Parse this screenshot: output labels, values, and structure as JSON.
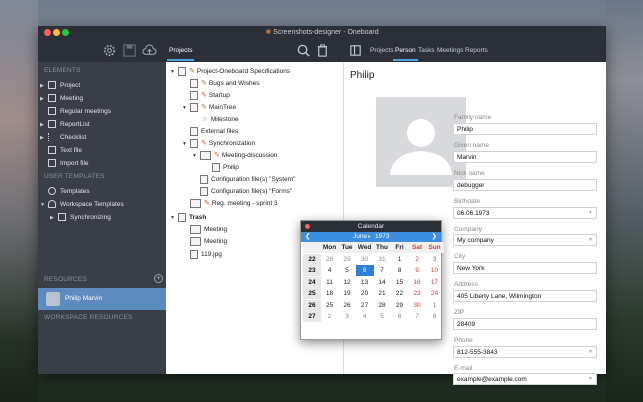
{
  "window": {
    "title": "Screenshots-designer - Oneboard"
  },
  "toolbar": {
    "left_tab": "Projects",
    "tabs": [
      {
        "label": "Projects",
        "active": false
      },
      {
        "label": "Person",
        "active": true
      },
      {
        "label": "Tasks",
        "active": false
      },
      {
        "label": "Meetings",
        "active": false
      },
      {
        "label": "Reports",
        "active": false
      }
    ]
  },
  "sidebar": {
    "elements_header": "ELEMENTS",
    "elements": [
      {
        "label": "Project",
        "icon": "project-icon"
      },
      {
        "label": "Meeting",
        "icon": "meeting-icon"
      },
      {
        "label": "Regular meetings",
        "icon": "regular-meetings-icon"
      },
      {
        "label": "ReportList",
        "icon": "report-list-icon"
      },
      {
        "label": "Checklist",
        "icon": "checklist-icon"
      },
      {
        "label": "Text file",
        "icon": "text-file-icon"
      },
      {
        "label": "Import file",
        "icon": "import-file-icon"
      }
    ],
    "user_templates_header": "USER TEMPLATES",
    "templates": [
      {
        "label": "Templates",
        "icon": "globe-icon"
      },
      {
        "label": "Workspace Templates",
        "icon": "cloud-icon"
      },
      {
        "label": "Synchronizing",
        "icon": "synchronizing-icon"
      }
    ],
    "resources_header": "RESOURCES",
    "resource_selected": "Philip Marvin",
    "workspace_resources_header": "WORKSPACE RESOURCES"
  },
  "tree": [
    {
      "label": "Project-Oneboard Specifications"
    },
    {
      "label": "Bugs and Wishes"
    },
    {
      "label": "Startup"
    },
    {
      "label": "MainTree"
    },
    {
      "label": "Milestone"
    },
    {
      "label": "External files"
    },
    {
      "label": "Synchronization"
    },
    {
      "label": "Meeting-discussion"
    },
    {
      "label": "Philip"
    },
    {
      "label": "Configuration file(s) \"System\""
    },
    {
      "label": "Configuration file(s) \"Forms\""
    },
    {
      "label": "Reg. meeting - sprint 3"
    },
    {
      "label": "Trash"
    },
    {
      "label": "Meeting"
    },
    {
      "label": "Meeting"
    },
    {
      "label": "119.jpg"
    }
  ],
  "person": {
    "name": "Philip",
    "fields": [
      {
        "label": "Family name",
        "value": "Philip"
      },
      {
        "label": "Given name",
        "value": "Marvin"
      },
      {
        "label": "Nick name",
        "value": "debugger"
      },
      {
        "label": "Birthdate",
        "value": "06.06.1973"
      },
      {
        "label": "Company",
        "value": "My company"
      },
      {
        "label": "City",
        "value": "New York"
      },
      {
        "label": "Address",
        "value": "405 Liberty Lane, Wilmington"
      },
      {
        "label": "ZIP",
        "value": "28409"
      },
      {
        "label": "Phone",
        "value": "812-555-3843"
      },
      {
        "label": "E-mail",
        "value": "example@example.com"
      }
    ]
  },
  "calendar": {
    "title": "Calendar",
    "month": "June",
    "year": "1973",
    "weekdays": [
      "Mon",
      "Tue",
      "Wed",
      "Thu",
      "Fri",
      "Sat",
      "Sun"
    ],
    "weeks": [
      {
        "wk": "22",
        "days": [
          "28",
          "29",
          "30",
          "31",
          "1",
          "2",
          "3"
        ]
      },
      {
        "wk": "23",
        "days": [
          "4",
          "5",
          "6",
          "7",
          "8",
          "9",
          "10"
        ]
      },
      {
        "wk": "24",
        "days": [
          "11",
          "12",
          "13",
          "14",
          "15",
          "16",
          "17"
        ]
      },
      {
        "wk": "25",
        "days": [
          "18",
          "19",
          "20",
          "21",
          "22",
          "23",
          "24"
        ]
      },
      {
        "wk": "26",
        "days": [
          "25",
          "26",
          "27",
          "28",
          "29",
          "30",
          "1"
        ]
      },
      {
        "wk": "27",
        "days": [
          "2",
          "3",
          "4",
          "5",
          "6",
          "7",
          "8"
        ]
      }
    ],
    "selected_day": "6"
  },
  "colors": {
    "accent": "#4aa3e0",
    "selection": "#5e8bbf",
    "weekend": "#e03434",
    "calendar_nav": "#3d8ee0"
  }
}
